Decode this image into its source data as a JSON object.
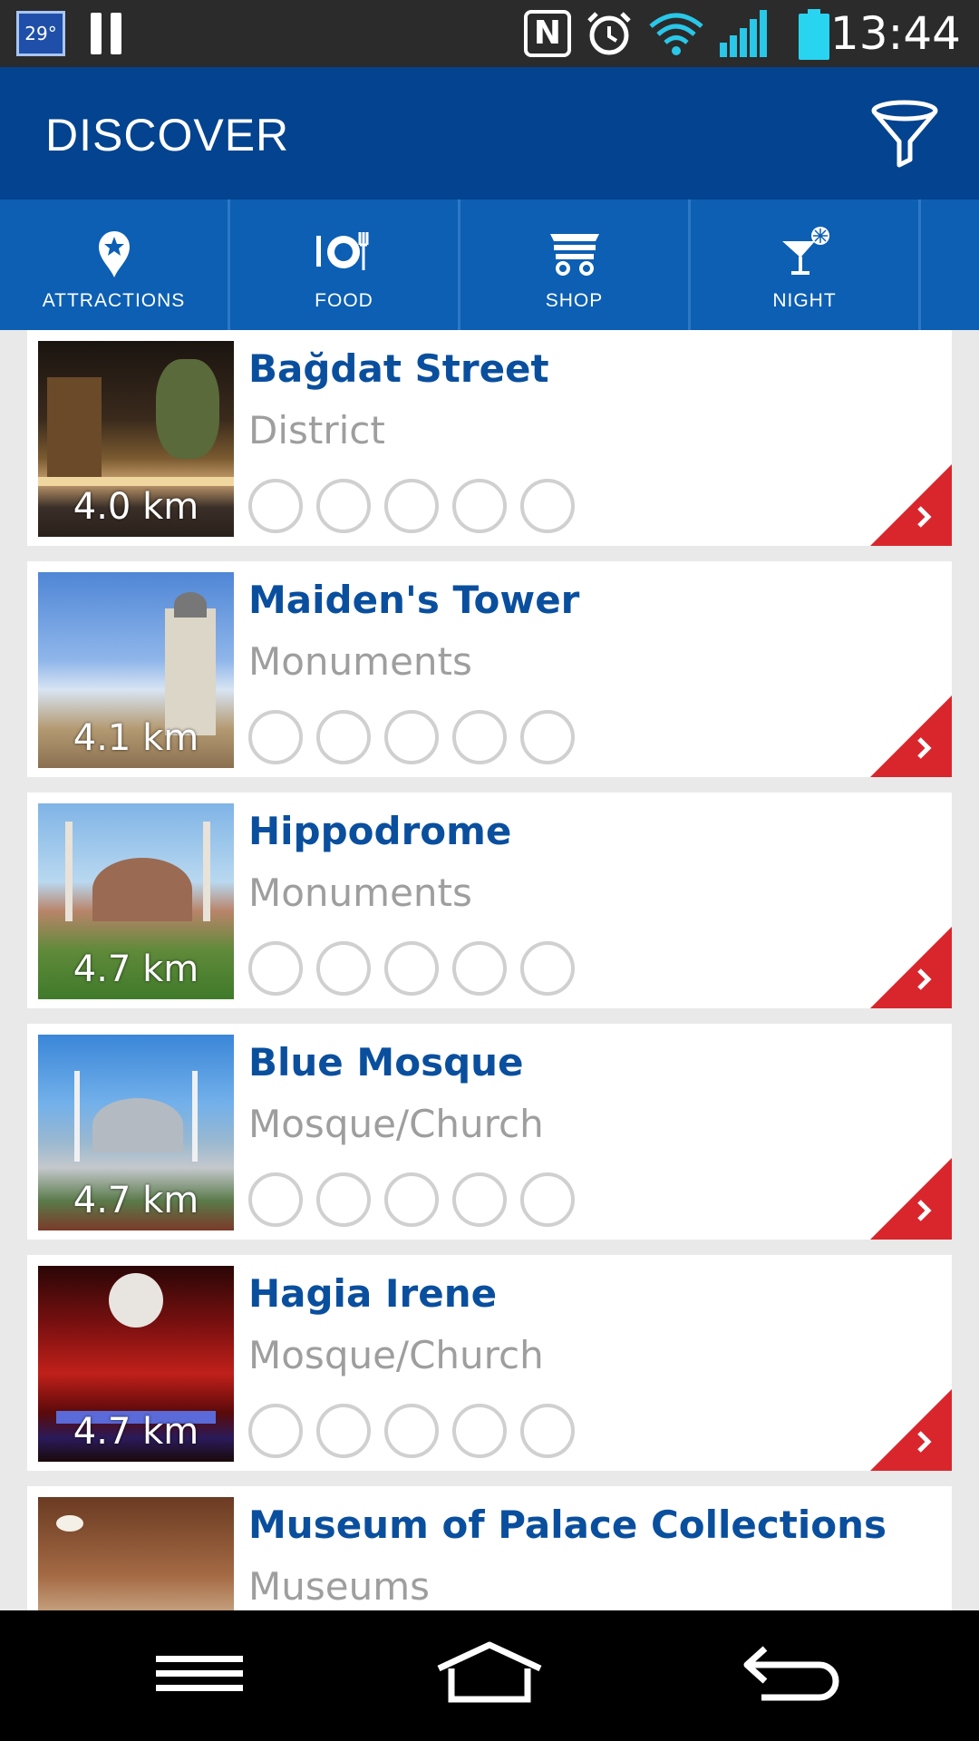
{
  "status_bar": {
    "temperature": "29°",
    "time": "13:44",
    "nfc_label": "N",
    "icons": [
      "pause-icon",
      "nfc-icon",
      "alarm-icon",
      "wifi-icon",
      "signal-icon",
      "battery-icon"
    ]
  },
  "app_bar": {
    "title": "DISCOVER",
    "filter_icon": "filter-icon"
  },
  "tabs": [
    {
      "label": "ATTRACTIONS",
      "icon": "map-pin-star-icon"
    },
    {
      "label": "FOOD",
      "icon": "plate-cutlery-icon"
    },
    {
      "label": "SHOP",
      "icon": "shopping-cart-icon"
    },
    {
      "label": "NIGHT",
      "icon": "cocktail-icon"
    }
  ],
  "places": [
    {
      "name": "Bağdat Street",
      "category": "District",
      "distance": "4.0 km",
      "rating": 0
    },
    {
      "name": "Maiden's Tower",
      "category": "Monuments",
      "distance": "4.1 km",
      "rating": 0
    },
    {
      "name": "Hippodrome",
      "category": "Monuments",
      "distance": "4.7 km",
      "rating": 0
    },
    {
      "name": "Blue Mosque",
      "category": "Mosque/Church",
      "distance": "4.7 km",
      "rating": 0
    },
    {
      "name": "Hagia Irene",
      "category": "Mosque/Church",
      "distance": "4.7 km",
      "rating": 0
    },
    {
      "name": "Museum of Palace Collections",
      "category": "Museums",
      "distance": "",
      "rating": 0
    }
  ],
  "colors": {
    "app_bar": "#03438f",
    "tabs": "#0c5fb3",
    "title_text": "#0a4f9e",
    "category_text": "#9e9e9e",
    "corner_arrow": "#d9262c"
  },
  "nav_bar": {
    "buttons": [
      "menu-icon",
      "home-icon",
      "back-icon"
    ]
  }
}
